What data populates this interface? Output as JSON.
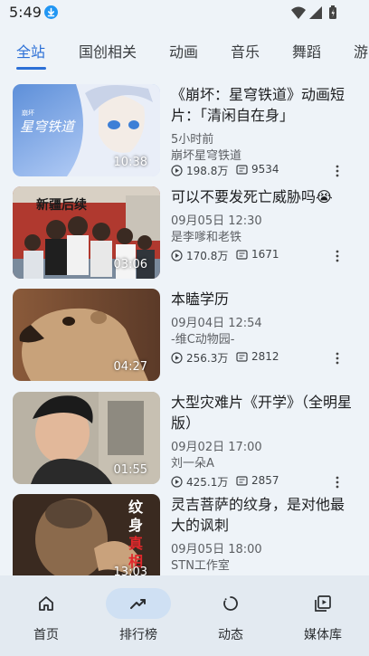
{
  "status_bar": {
    "time": "5:49"
  },
  "tabs": [
    {
      "label": "全站",
      "active": true
    },
    {
      "label": "国创相关",
      "active": false
    },
    {
      "label": "动画",
      "active": false
    },
    {
      "label": "音乐",
      "active": false
    },
    {
      "label": "舞蹈",
      "active": false
    },
    {
      "label": "游",
      "active": false
    }
  ],
  "videos": [
    {
      "title": "《崩坏：星穹铁道》动画短片：「清闲自在身」",
      "date": "5小时前",
      "author": "崩坏星穹铁道",
      "views": "198.8万",
      "danmaku": "9534",
      "duration": "10:38"
    },
    {
      "title": "可以不要发死亡威胁吗😭",
      "date": "09月05日 12:30",
      "author": "是李嗲和老铁",
      "views": "170.8万",
      "danmaku": "1671",
      "duration": "03:06"
    },
    {
      "title": "本瞌学历",
      "date": "09月04日 12:54",
      "author": "-维C动物园-",
      "views": "256.3万",
      "danmaku": "2812",
      "duration": "04:27"
    },
    {
      "title": "大型灾难片《开学》（全明星版）",
      "date": "09月02日 17:00",
      "author": "刘一朵A",
      "views": "425.1万",
      "danmaku": "2857",
      "duration": "01:55"
    },
    {
      "title": "灵吉菩萨的纹身，是对他最大的讽刺",
      "date": "09月05日 18:00",
      "author": "STN工作室",
      "views": "",
      "danmaku": "",
      "duration": "13:03"
    }
  ],
  "thumb_texts": {
    "v1_logo_top": "崩坏",
    "v1_logo_main": "星穹铁道",
    "v2_caption": "新疆后续",
    "v5_caption_1": "纹",
    "v5_caption_2": "身",
    "v5_caption_3": "真",
    "v5_caption_4": "相"
  },
  "bottom_nav": [
    {
      "label": "首页",
      "icon": "home-icon",
      "active": false
    },
    {
      "label": "排行榜",
      "icon": "trending-icon",
      "active": true
    },
    {
      "label": "动态",
      "icon": "refresh-icon",
      "active": false
    },
    {
      "label": "媒体库",
      "icon": "media-library-icon",
      "active": false
    }
  ],
  "colors": {
    "accent": "#2b6fd6",
    "background": "#eef3f8",
    "nav_pill": "#cfe0f3"
  }
}
